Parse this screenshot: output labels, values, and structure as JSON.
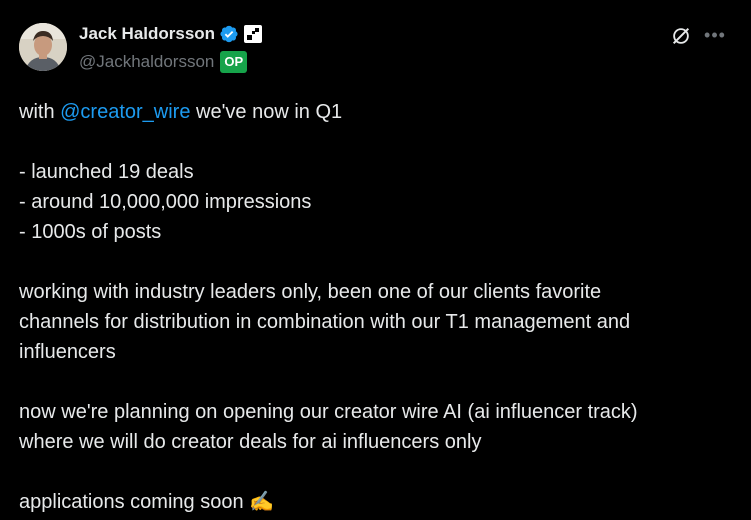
{
  "author": {
    "display_name": "Jack Haldorsson",
    "handle": "@Jackhaldorsson",
    "op_badge": "OP",
    "verified_icon": "verified-badge-icon",
    "affiliate_icon": "affiliate-badge-icon",
    "avatar_icon": "avatar-photo"
  },
  "actions": {
    "grok_icon": "grok-icon",
    "more_icon": "more-options-icon"
  },
  "colors": {
    "background": "#000000",
    "text": "#e7e9ea",
    "muted": "#71767b",
    "link": "#1d9bf0",
    "verified": "#1d9bf0",
    "op_badge": "#16a34a"
  },
  "tweet": {
    "line1_prefix": "with ",
    "mention": "@creator_wire",
    "line1_suffix": " we've now in Q1",
    "bullet1": "- launched 19 deals",
    "bullet2": "- around 10,000,000 impressions",
    "bullet3": "- 1000s of posts",
    "para2_line1": "working with industry leaders only, been one of our clients favorite",
    "para2_line2": "channels for distribution in combination with our T1 management and",
    "para2_line3": "influencers",
    "para3_line1": "now we're planning on opening our creator wire AI (ai influencer track)",
    "para3_line2": "where we will do creator deals for ai influencers only",
    "closing": "applications coming soon ",
    "emoji": "✍️"
  }
}
